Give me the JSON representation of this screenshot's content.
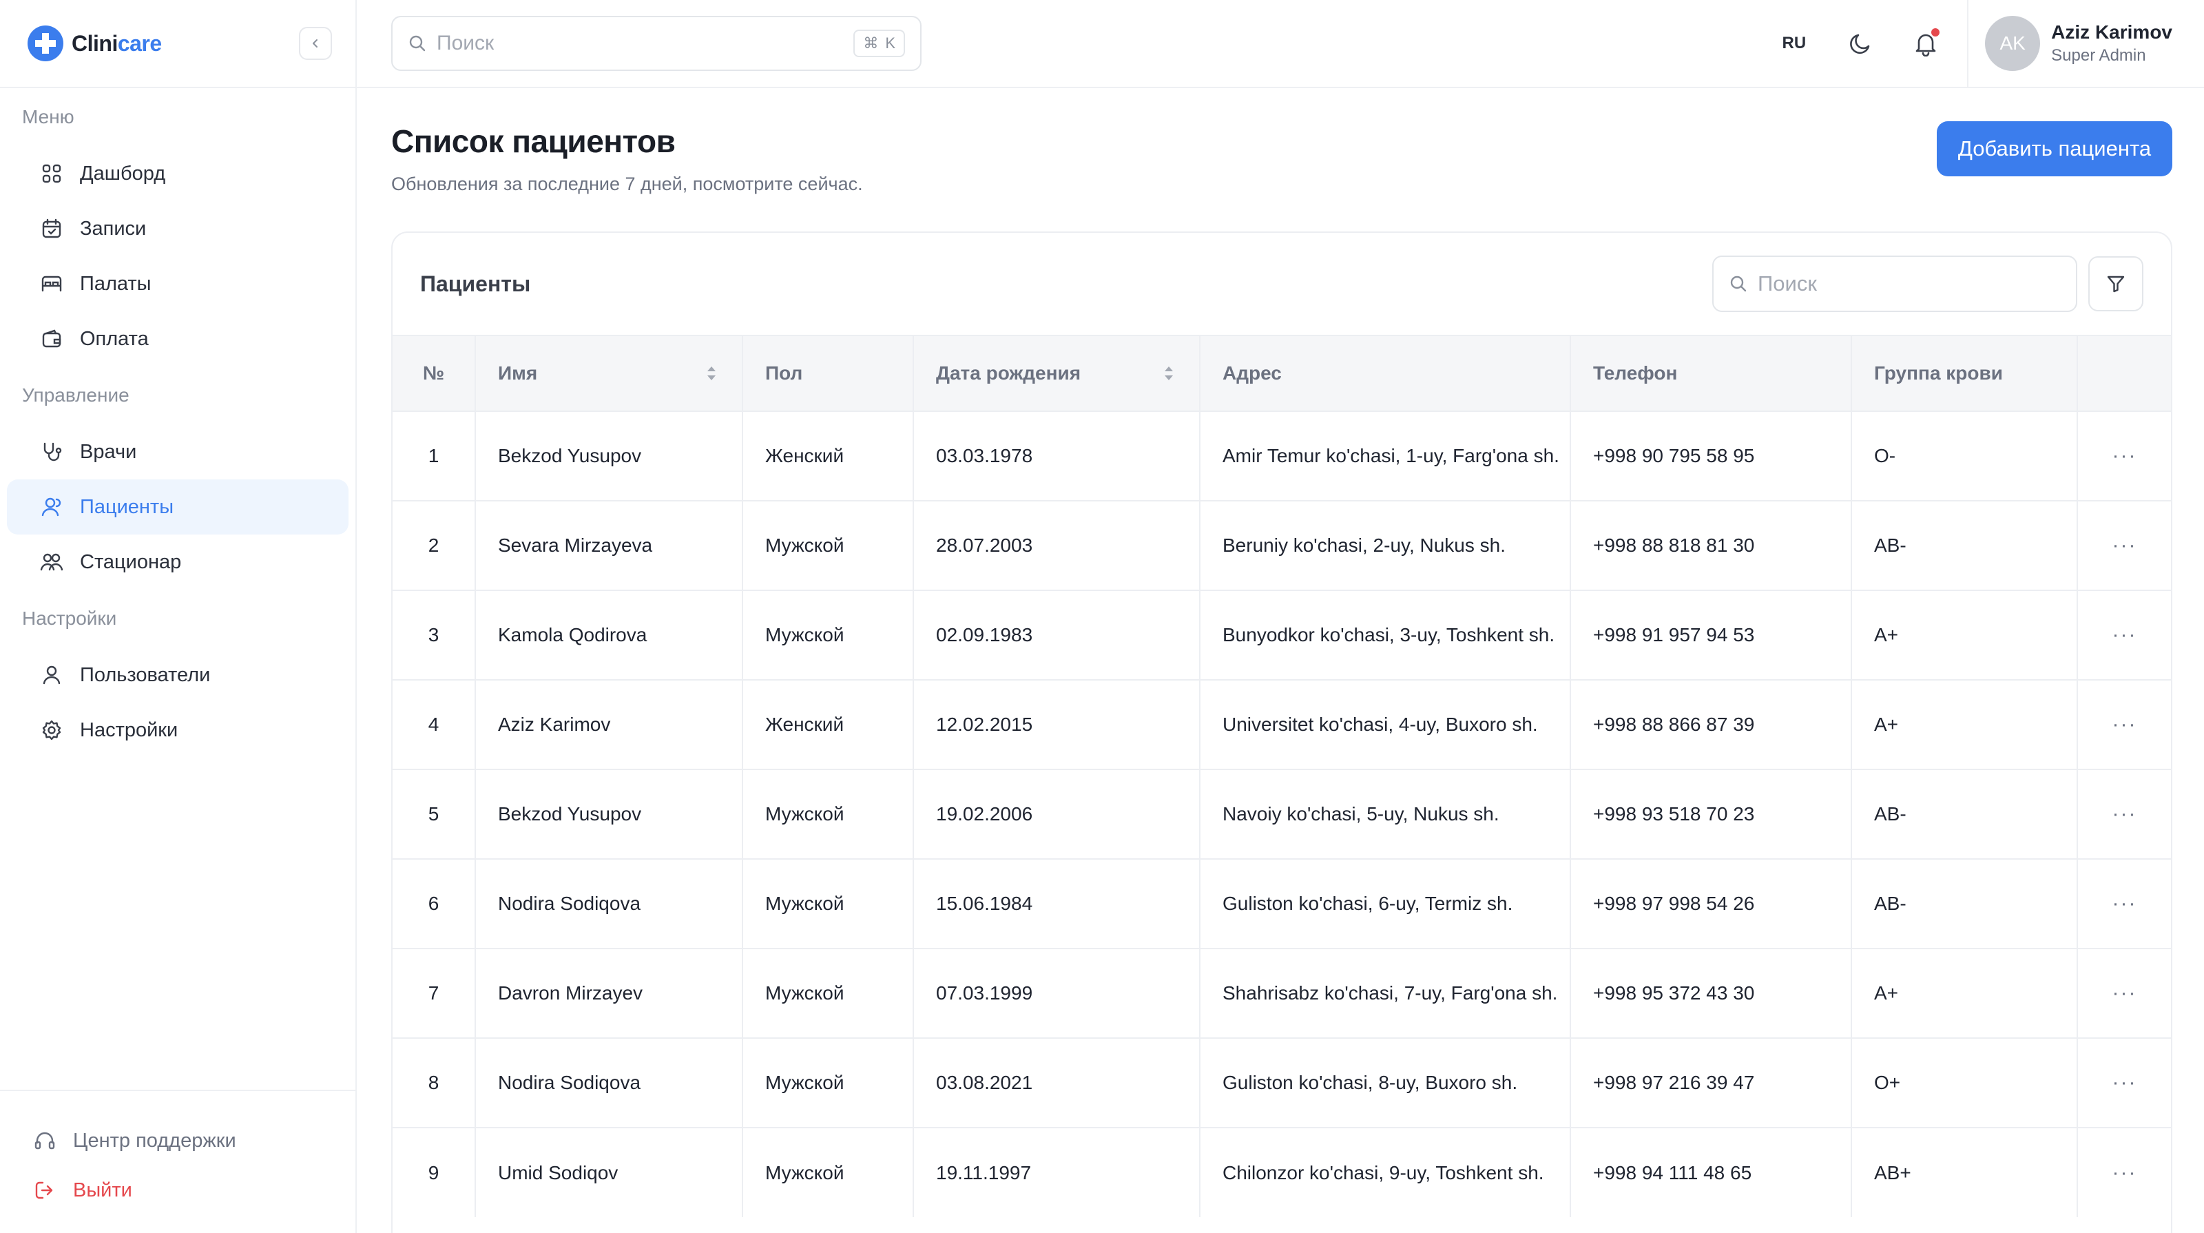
{
  "sidebar": {
    "logo_main": "Clini",
    "logo_accent": "care",
    "sections": {
      "menu": "Меню",
      "management": "Управление",
      "settings": "Настройки"
    },
    "items": {
      "dashboard": "Дашборд",
      "appointments": "Записи",
      "wards": "Палаты",
      "payment": "Оплата",
      "doctors": "Врачи",
      "patients": "Пациенты",
      "inpatient": "Стационар",
      "users": "Пользователи",
      "settings": "Настройки"
    },
    "support": "Центр поддержки",
    "logout": "Выйти"
  },
  "topbar": {
    "search_placeholder": "Поиск",
    "shortcut_key": "K",
    "lang": "RU",
    "user": {
      "initials": "AK",
      "name": "Aziz Karimov",
      "role": "Super Admin"
    }
  },
  "page": {
    "title": "Список пациентов",
    "subtitle": "Обновления за последние 7 дней, посмотрите сейчас.",
    "add_button": "Добавить пациента"
  },
  "card": {
    "title": "Пациенты",
    "search_placeholder": "Поиск"
  },
  "table": {
    "columns": {
      "num": "№",
      "name": "Имя",
      "gender": "Пол",
      "dob": "Дата рождения",
      "address": "Адрес",
      "phone": "Телефон",
      "blood": "Группа крови"
    },
    "rows": [
      {
        "num": "1",
        "name": "Bekzod Yusupov",
        "gender": "Женский",
        "dob": "03.03.1978",
        "address": "Amir Temur ko'chasi, 1-uy, Farg'ona sh.",
        "phone": "+998 90 795 58 95",
        "blood": "O-"
      },
      {
        "num": "2",
        "name": "Sevara Mirzayeva",
        "gender": "Мужской",
        "dob": "28.07.2003",
        "address": "Beruniy ko'chasi, 2-uy, Nukus sh.",
        "phone": "+998 88 818 81 30",
        "blood": "AB-"
      },
      {
        "num": "3",
        "name": "Kamola Qodirova",
        "gender": "Мужской",
        "dob": "02.09.1983",
        "address": "Bunyodkor ko'chasi, 3-uy, Toshkent sh.",
        "phone": "+998 91 957 94 53",
        "blood": "A+"
      },
      {
        "num": "4",
        "name": "Aziz Karimov",
        "gender": "Женский",
        "dob": "12.02.2015",
        "address": "Universitet ko'chasi, 4-uy, Buxoro sh.",
        "phone": "+998 88 866 87 39",
        "blood": "A+"
      },
      {
        "num": "5",
        "name": "Bekzod Yusupov",
        "gender": "Мужской",
        "dob": "19.02.2006",
        "address": "Navoiy ko'chasi, 5-uy, Nukus sh.",
        "phone": "+998 93 518 70 23",
        "blood": "AB-"
      },
      {
        "num": "6",
        "name": "Nodira Sodiqova",
        "gender": "Мужской",
        "dob": "15.06.1984",
        "address": "Guliston ko'chasi, 6-uy, Termiz sh.",
        "phone": "+998 97 998 54 26",
        "blood": "AB-"
      },
      {
        "num": "7",
        "name": "Davron Mirzayev",
        "gender": "Мужской",
        "dob": "07.03.1999",
        "address": "Shahrisabz ko'chasi, 7-uy, Farg'ona sh.",
        "phone": "+998 95 372 43 30",
        "blood": "A+"
      },
      {
        "num": "8",
        "name": "Nodira Sodiqova",
        "gender": "Мужской",
        "dob": "03.08.2021",
        "address": "Guliston ko'chasi, 8-uy, Buxoro sh.",
        "phone": "+998 97 216 39 47",
        "blood": "O+"
      },
      {
        "num": "9",
        "name": "Umid Sodiqov",
        "gender": "Мужской",
        "dob": "19.11.1997",
        "address": "Chilonzor ko'chasi, 9-uy, Toshkent sh.",
        "phone": "+998 94 111 48 65",
        "blood": "AB+"
      }
    ]
  },
  "colors": {
    "accent": "#3b7ded",
    "active_bg": "#eef5fe",
    "danger": "#e5484d"
  }
}
